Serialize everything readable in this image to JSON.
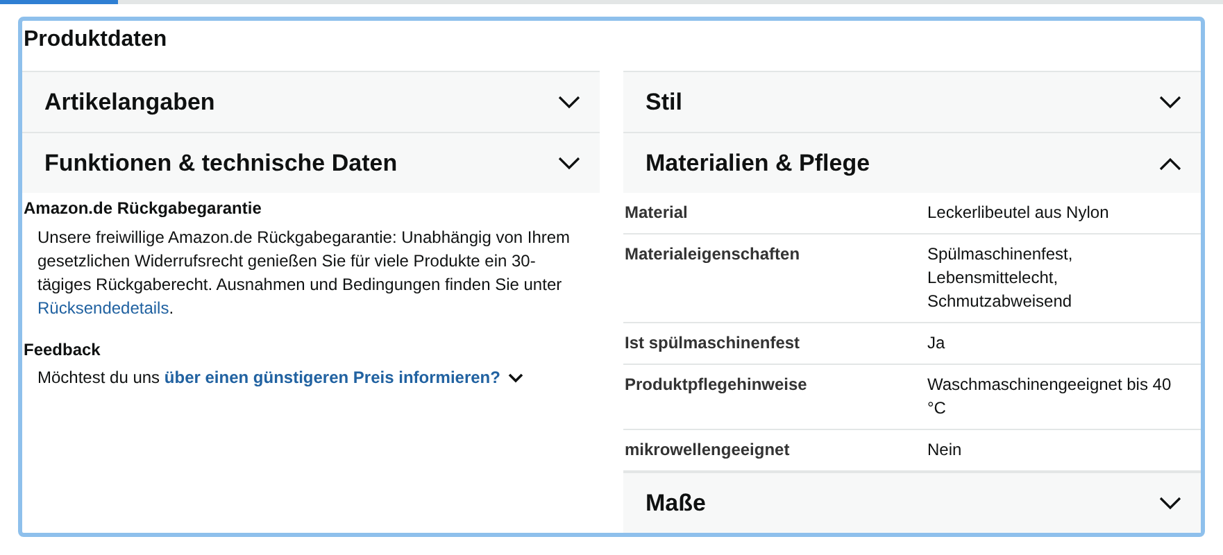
{
  "title": "Produktdaten",
  "left_sections": [
    {
      "label": "Artikelangaben",
      "expanded": false
    },
    {
      "label": "Funktionen & technische Daten",
      "expanded": false
    }
  ],
  "return_policy": {
    "heading": "Amazon.de Rückgabegarantie",
    "text": "Unsere freiwillige Amazon.de Rückgabegarantie:  Unabhängig von Ihrem gesetzlichen Widerrufsrecht genießen Sie für viele Produkte ein 30-tägiges Rückgaberecht. Ausnahmen und Bedingungen finden Sie unter",
    "link": "Rücksendedetails",
    "after": "."
  },
  "feedback": {
    "heading": "Feedback",
    "text": "Möchtest du uns",
    "link": "über einen günstigeren Preis informieren?"
  },
  "right_sections": [
    {
      "label": "Stil",
      "expanded": false
    },
    {
      "label": "Materialien & Pflege",
      "expanded": true,
      "rows": [
        {
          "name": "Material",
          "value": "Leckerlibeutel aus Nylon"
        },
        {
          "name": "Materialeigenschaften",
          "value": "Spülmaschinenfest, Lebensmittelecht, Schmutzabweisend"
        },
        {
          "name": "Ist spülmaschinenfest",
          "value": "Ja"
        },
        {
          "name": "Produktpflegehinweise",
          "value": "Waschmaschinengeeignet bis 40 °C"
        },
        {
          "name": "mikrowellengeeignet",
          "value": "Nein"
        }
      ]
    },
    {
      "label": "Maße",
      "expanded": false
    }
  ]
}
